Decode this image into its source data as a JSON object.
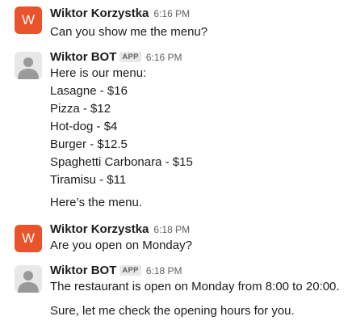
{
  "messages": [
    {
      "sender": "Wiktor Korzystka",
      "avatar_letter": "W",
      "time": "6:16 PM",
      "lines": [
        "Can you show me the menu?"
      ]
    },
    {
      "sender": "Wiktor BOT",
      "badge": "APP",
      "time": "6:16 PM",
      "lines": [
        "Here is our menu:",
        "Lasagne - $16",
        "Pizza - $12",
        "Hot-dog - $4",
        "Burger - $12.5",
        "Spaghetti Carbonara - $15",
        "Tiramisu - $11"
      ],
      "followup": "Here’s the menu."
    },
    {
      "sender": "Wiktor Korzystka",
      "avatar_letter": "W",
      "time": "6:18 PM",
      "lines": [
        "Are you open on Monday?"
      ]
    },
    {
      "sender": "Wiktor BOT",
      "badge": "APP",
      "time": "6:18 PM",
      "lines": [
        "The restaurant is open on Monday from 8:00 to 20:00."
      ],
      "followup": "Sure, let me check the opening hours for you."
    }
  ],
  "colors": {
    "user_avatar": "#e8532b",
    "bot_avatar_bg": "#e8e8e8",
    "bot_avatar_figure": "#9a9a9a",
    "text": "#1d1c1d",
    "muted": "#616061"
  }
}
